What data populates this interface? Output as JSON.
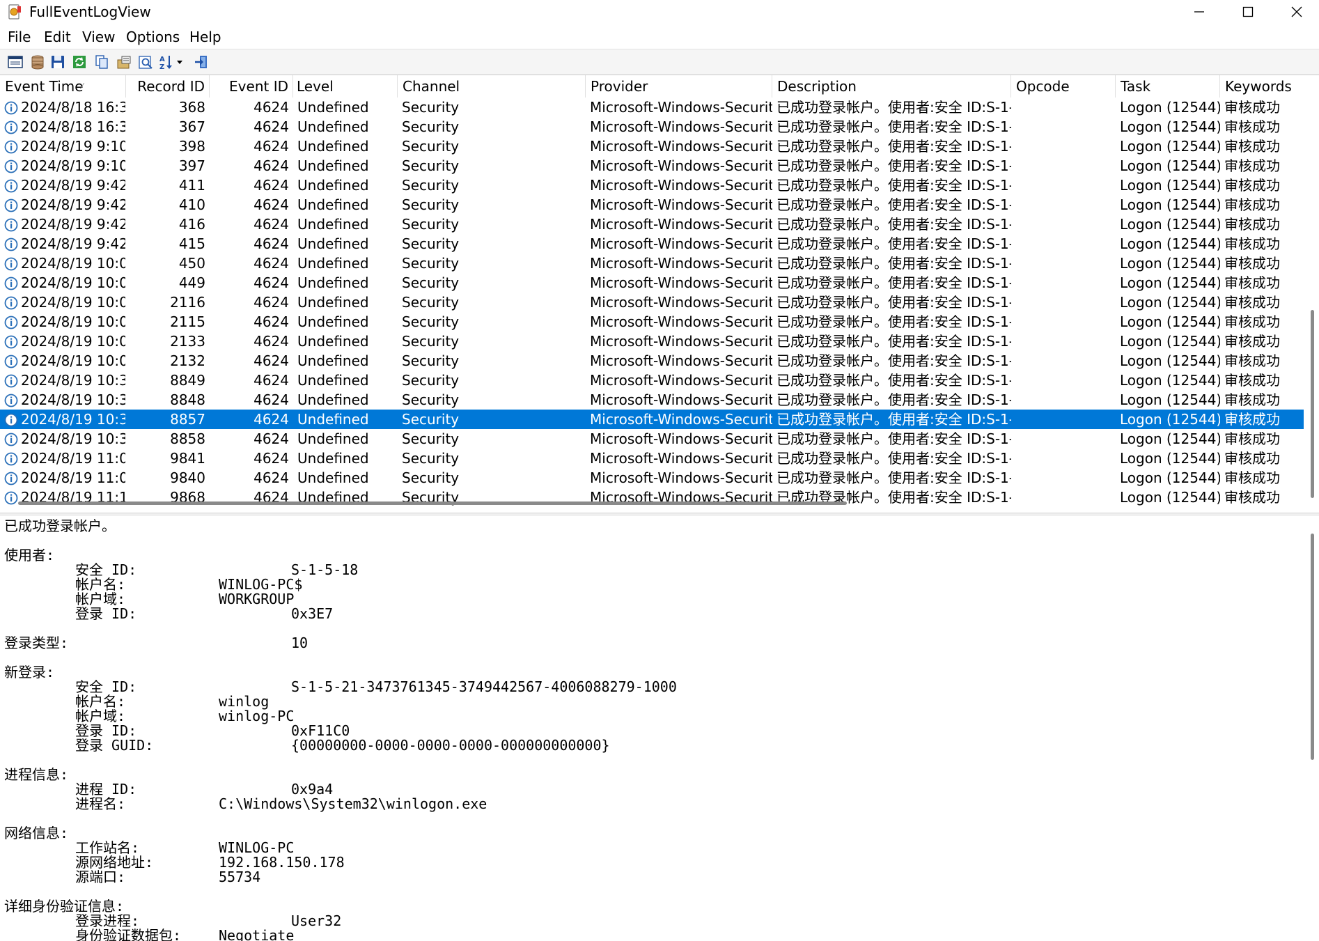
{
  "window": {
    "title": "FullEventLogView",
    "icon": "event-log-app-icon"
  },
  "menu": [
    "File",
    "Edit",
    "View",
    "Options",
    "Help"
  ],
  "toolbar": [
    "properties-icon",
    "database-icon",
    "save-icon",
    "refresh-icon",
    "copy-icon",
    "options-icon",
    "find-icon",
    "sort-icon",
    "exit-icon"
  ],
  "columns": {
    "event_time": "Event Time",
    "record_id": "Record ID",
    "event_id": "Event ID",
    "level": "Level",
    "channel": "Channel",
    "provider": "Provider",
    "description": "Description",
    "opcode": "Opcode",
    "task": "Task",
    "keywords": "Keywords"
  },
  "rows": [
    {
      "time": "2024/8/18 16:3...",
      "record": "368",
      "event": "4624",
      "level": "Undefined",
      "channel": "Security",
      "provider": "Microsoft-Windows-Securit...",
      "desc": "已成功登录帐户。使用者:安全 ID:S-1-5...",
      "opcode": "",
      "task": "Logon (12544)",
      "keywords": "审核成功"
    },
    {
      "time": "2024/8/18 16:3...",
      "record": "367",
      "event": "4624",
      "level": "Undefined",
      "channel": "Security",
      "provider": "Microsoft-Windows-Securit...",
      "desc": "已成功登录帐户。使用者:安全 ID:S-1-5...",
      "opcode": "",
      "task": "Logon (12544)",
      "keywords": "审核成功"
    },
    {
      "time": "2024/8/19 9:10...",
      "record": "398",
      "event": "4624",
      "level": "Undefined",
      "channel": "Security",
      "provider": "Microsoft-Windows-Securit...",
      "desc": "已成功登录帐户。使用者:安全 ID:S-1-5...",
      "opcode": "",
      "task": "Logon (12544)",
      "keywords": "审核成功"
    },
    {
      "time": "2024/8/19 9:10...",
      "record": "397",
      "event": "4624",
      "level": "Undefined",
      "channel": "Security",
      "provider": "Microsoft-Windows-Securit...",
      "desc": "已成功登录帐户。使用者:安全 ID:S-1-5...",
      "opcode": "",
      "task": "Logon (12544)",
      "keywords": "审核成功"
    },
    {
      "time": "2024/8/19 9:42...",
      "record": "411",
      "event": "4624",
      "level": "Undefined",
      "channel": "Security",
      "provider": "Microsoft-Windows-Securit...",
      "desc": "已成功登录帐户。使用者:安全 ID:S-1-5...",
      "opcode": "",
      "task": "Logon (12544)",
      "keywords": "审核成功"
    },
    {
      "time": "2024/8/19 9:42...",
      "record": "410",
      "event": "4624",
      "level": "Undefined",
      "channel": "Security",
      "provider": "Microsoft-Windows-Securit...",
      "desc": "已成功登录帐户。使用者:安全 ID:S-1-5...",
      "opcode": "",
      "task": "Logon (12544)",
      "keywords": "审核成功"
    },
    {
      "time": "2024/8/19 9:42...",
      "record": "416",
      "event": "4624",
      "level": "Undefined",
      "channel": "Security",
      "provider": "Microsoft-Windows-Securit...",
      "desc": "已成功登录帐户。使用者:安全 ID:S-1-5...",
      "opcode": "",
      "task": "Logon (12544)",
      "keywords": "审核成功"
    },
    {
      "time": "2024/8/19 9:42...",
      "record": "415",
      "event": "4624",
      "level": "Undefined",
      "channel": "Security",
      "provider": "Microsoft-Windows-Securit...",
      "desc": "已成功登录帐户。使用者:安全 ID:S-1-5...",
      "opcode": "",
      "task": "Logon (12544)",
      "keywords": "审核成功"
    },
    {
      "time": "2024/8/19 10:0...",
      "record": "450",
      "event": "4624",
      "level": "Undefined",
      "channel": "Security",
      "provider": "Microsoft-Windows-Securit...",
      "desc": "已成功登录帐户。使用者:安全 ID:S-1-5...",
      "opcode": "",
      "task": "Logon (12544)",
      "keywords": "审核成功"
    },
    {
      "time": "2024/8/19 10:0...",
      "record": "449",
      "event": "4624",
      "level": "Undefined",
      "channel": "Security",
      "provider": "Microsoft-Windows-Securit...",
      "desc": "已成功登录帐户。使用者:安全 ID:S-1-5...",
      "opcode": "",
      "task": "Logon (12544)",
      "keywords": "审核成功"
    },
    {
      "time": "2024/8/19 10:0...",
      "record": "2116",
      "event": "4624",
      "level": "Undefined",
      "channel": "Security",
      "provider": "Microsoft-Windows-Securit...",
      "desc": "已成功登录帐户。使用者:安全 ID:S-1-5...",
      "opcode": "",
      "task": "Logon (12544)",
      "keywords": "审核成功"
    },
    {
      "time": "2024/8/19 10:0...",
      "record": "2115",
      "event": "4624",
      "level": "Undefined",
      "channel": "Security",
      "provider": "Microsoft-Windows-Securit...",
      "desc": "已成功登录帐户。使用者:安全 ID:S-1-5...",
      "opcode": "",
      "task": "Logon (12544)",
      "keywords": "审核成功"
    },
    {
      "time": "2024/8/19 10:0...",
      "record": "2133",
      "event": "4624",
      "level": "Undefined",
      "channel": "Security",
      "provider": "Microsoft-Windows-Securit...",
      "desc": "已成功登录帐户。使用者:安全 ID:S-1-5...",
      "opcode": "",
      "task": "Logon (12544)",
      "keywords": "审核成功"
    },
    {
      "time": "2024/8/19 10:0...",
      "record": "2132",
      "event": "4624",
      "level": "Undefined",
      "channel": "Security",
      "provider": "Microsoft-Windows-Securit...",
      "desc": "已成功登录帐户。使用者:安全 ID:S-1-5...",
      "opcode": "",
      "task": "Logon (12544)",
      "keywords": "审核成功"
    },
    {
      "time": "2024/8/19 10:3...",
      "record": "8849",
      "event": "4624",
      "level": "Undefined",
      "channel": "Security",
      "provider": "Microsoft-Windows-Securit...",
      "desc": "已成功登录帐户。使用者:安全 ID:S-1-5...",
      "opcode": "",
      "task": "Logon (12544)",
      "keywords": "审核成功"
    },
    {
      "time": "2024/8/19 10:3...",
      "record": "8848",
      "event": "4624",
      "level": "Undefined",
      "channel": "Security",
      "provider": "Microsoft-Windows-Securit...",
      "desc": "已成功登录帐户。使用者:安全 ID:S-1-5...",
      "opcode": "",
      "task": "Logon (12544)",
      "keywords": "审核成功"
    },
    {
      "time": "2024/8/19 10:3...",
      "record": "8857",
      "event": "4624",
      "level": "Undefined",
      "channel": "Security",
      "provider": "Microsoft-Windows-Securit...",
      "desc": "已成功登录帐户。使用者:安全 ID:S-1-5...",
      "opcode": "",
      "task": "Logon (12544)",
      "keywords": "审核成功",
      "selected": true
    },
    {
      "time": "2024/8/19 10:3...",
      "record": "8858",
      "event": "4624",
      "level": "Undefined",
      "channel": "Security",
      "provider": "Microsoft-Windows-Securit...",
      "desc": "已成功登录帐户。使用者:安全 ID:S-1-5...",
      "opcode": "",
      "task": "Logon (12544)",
      "keywords": "审核成功"
    },
    {
      "time": "2024/8/19 11:0...",
      "record": "9841",
      "event": "4624",
      "level": "Undefined",
      "channel": "Security",
      "provider": "Microsoft-Windows-Securit...",
      "desc": "已成功登录帐户。使用者:安全 ID:S-1-5...",
      "opcode": "",
      "task": "Logon (12544)",
      "keywords": "审核成功"
    },
    {
      "time": "2024/8/19 11:0...",
      "record": "9840",
      "event": "4624",
      "level": "Undefined",
      "channel": "Security",
      "provider": "Microsoft-Windows-Securit...",
      "desc": "已成功登录帐户。使用者:安全 ID:S-1-5...",
      "opcode": "",
      "task": "Logon (12544)",
      "keywords": "审核成功"
    },
    {
      "time": "2024/8/19 11:1...",
      "record": "9868",
      "event": "4624",
      "level": "Undefined",
      "channel": "Security",
      "provider": "Microsoft-Windows-Securit...",
      "desc": "已成功登录帐户。使用者:安全 ID:S-1-5...",
      "opcode": "",
      "task": "Logon (12544)",
      "keywords": "审核成功"
    }
  ],
  "details": {
    "summary": "已成功登录帐户。",
    "subject_heading": "使用者:",
    "subject": [
      {
        "label": "安全 ID:",
        "value": "S-1-5-18",
        "indent": "far"
      },
      {
        "label": "帐户名:",
        "value": "WINLOG-PC$",
        "indent": "near"
      },
      {
        "label": "帐户域:",
        "value": "WORKGROUP",
        "indent": "near"
      },
      {
        "label": "登录 ID:",
        "value": "0x3E7",
        "indent": "far"
      }
    ],
    "logon_type_label": "登录类型:",
    "logon_type_value": "10",
    "new_logon_heading": "新登录:",
    "new_logon": [
      {
        "label": "安全 ID:",
        "value": "S-1-5-21-3473761345-3749442567-4006088279-1000",
        "indent": "far"
      },
      {
        "label": "帐户名:",
        "value": "winlog",
        "indent": "near"
      },
      {
        "label": "帐户域:",
        "value": "winlog-PC",
        "indent": "near"
      },
      {
        "label": "登录 ID:",
        "value": "0xF11C0",
        "indent": "far"
      },
      {
        "label": "登录 GUID:",
        "value": "{00000000-0000-0000-0000-000000000000}",
        "indent": "far"
      }
    ],
    "process_heading": "进程信息:",
    "process": [
      {
        "label": "进程 ID:",
        "value": "0x9a4",
        "indent": "far"
      },
      {
        "label": "进程名:",
        "value": "C:\\Windows\\System32\\winlogon.exe",
        "indent": "near"
      }
    ],
    "network_heading": "网络信息:",
    "network": [
      {
        "label": "工作站名:",
        "value": "WINLOG-PC",
        "indent": "near"
      },
      {
        "label": "源网络地址:",
        "value": "192.168.150.178",
        "indent": "near"
      },
      {
        "label": "源端口:",
        "value": "55734",
        "indent": "near"
      }
    ],
    "auth_heading": "详细身份验证信息:",
    "auth": [
      {
        "label": "登录进程:",
        "value": "User32",
        "indent": "far"
      },
      {
        "label": "身份验证数据包:",
        "value": "Negotiate",
        "indent": "near"
      }
    ]
  },
  "colors": {
    "selection": "#0078d7",
    "info_icon": "#2a6fb8"
  }
}
